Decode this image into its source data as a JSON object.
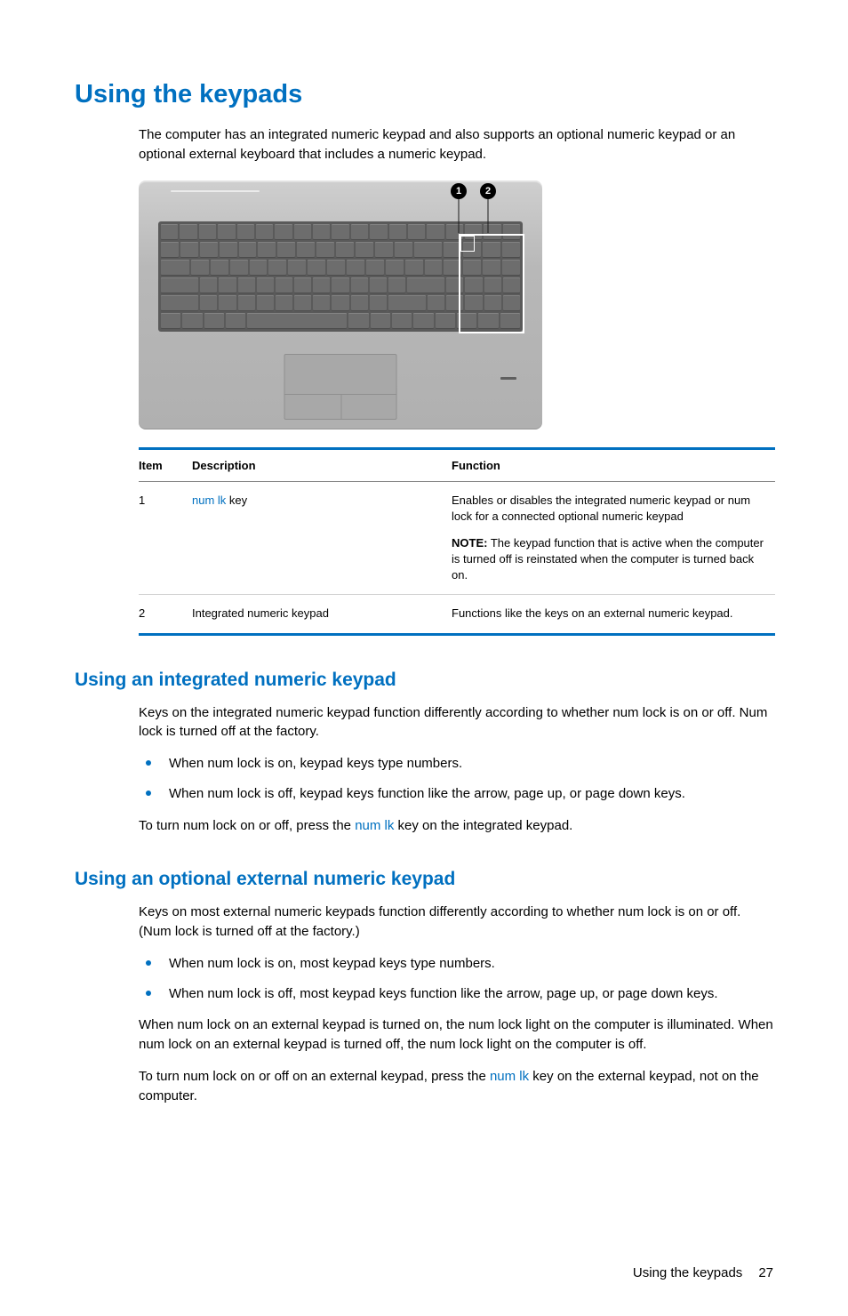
{
  "heading_main": "Using the keypads",
  "intro": "The computer has an integrated numeric keypad and also supports an optional numeric keypad or an optional external keyboard that includes a numeric keypad.",
  "callouts": {
    "c1": "1",
    "c2": "2"
  },
  "table": {
    "headers": {
      "item": "Item",
      "description": "Description",
      "function": "Function"
    },
    "rows": [
      {
        "item": "1",
        "desc_link": "num lk",
        "desc_rest": " key",
        "func": "Enables or disables the integrated numeric keypad or num lock for a connected optional numeric keypad",
        "note_label": "NOTE:",
        "note": "The keypad function that is active when the computer is turned off is reinstated when the computer is turned back on."
      },
      {
        "item": "2",
        "desc": "Integrated numeric keypad",
        "func": "Functions like the keys on an external numeric keypad."
      }
    ]
  },
  "section_integrated": {
    "heading": "Using an integrated numeric keypad",
    "p1": "Keys on the integrated numeric keypad function differently according to whether num lock is on or off. Num lock is turned off at the factory.",
    "b1": "When num lock is on, keypad keys type numbers.",
    "b2": "When num lock is off, keypad keys function like the arrow, page up, or page down keys.",
    "p2_pre": "To turn num lock on or off, press the ",
    "p2_link": "num lk",
    "p2_post": " key on the integrated keypad."
  },
  "section_external": {
    "heading": "Using an optional external numeric keypad",
    "p1": "Keys on most external numeric keypads function differently according to whether num lock is on or off. (Num lock is turned off at the factory.)",
    "b1": "When num lock is on, most keypad keys type numbers.",
    "b2": "When num lock is off, most keypad keys function like the arrow, page up, or page down keys.",
    "p2": "When num lock on an external keypad is turned on, the num lock light on the computer is illuminated. When num lock on an external keypad is turned off, the num lock light on the computer is off.",
    "p3_pre": "To turn num lock on or off on an external keypad, press the ",
    "p3_link": "num lk",
    "p3_post": " key on the external keypad, not on the computer."
  },
  "footer": {
    "title": "Using the keypads",
    "page": "27"
  }
}
